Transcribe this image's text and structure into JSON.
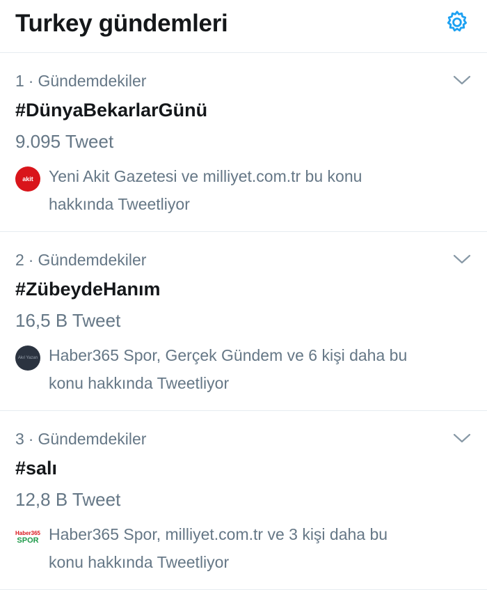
{
  "header": {
    "title": "Turkey gündemleri",
    "settings_icon": "gear-icon"
  },
  "colors": {
    "accent": "#1da1f2",
    "secondary_text": "#657786",
    "divider": "#e6ecf0"
  },
  "trends": [
    {
      "rank": "1",
      "category": "Gündemdekiler",
      "hashtag": "#DünyaBekarlarGünü",
      "count": "9.095 Tweet",
      "avatar_label": "akit",
      "context_line1": "Yeni Akit Gazetesi ve milliyet.com.tr bu konu",
      "context_line2": "hakkında Tweetliyor"
    },
    {
      "rank": "2",
      "category": "Gündemdekiler",
      "hashtag": "#ZübeydeHanım",
      "count": "16,5 B Tweet",
      "avatar_label": "Akıl Yazan",
      "context_line1": "Haber365 Spor, Gerçek Gündem ve 6 kişi daha bu",
      "context_line2": "konu hakkında Tweetliyor"
    },
    {
      "rank": "3",
      "category": "Gündemdekiler",
      "hashtag": "#salı",
      "count": "12,8 B Tweet",
      "avatar_label_top": "Haber365",
      "avatar_label_bottom": "SPOR",
      "context_line1": "Haber365 Spor, milliyet.com.tr ve 3 kişi daha bu",
      "context_line2": "konu hakkında Tweetliyor"
    }
  ]
}
